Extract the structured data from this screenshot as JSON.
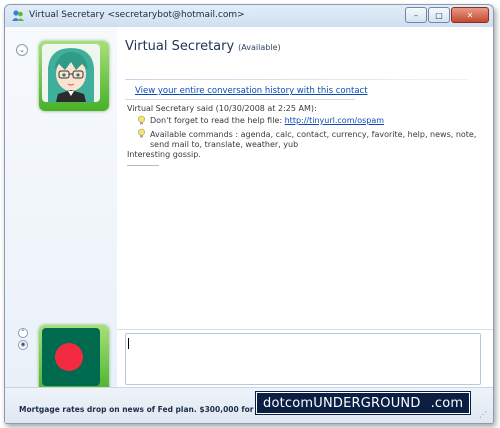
{
  "window": {
    "title": "Virtual Secretary <secretarybot@hotmail.com>",
    "minimize_label": "–",
    "maximize_label": "□",
    "close_label": "✕"
  },
  "contact": {
    "name": "Virtual Secretary",
    "status": "(Available)",
    "avatar_icon": "anime-girl-avatar",
    "own_avatar_icon": "bangladesh-flag"
  },
  "conversation": {
    "history_link": "View your entire conversation history with this contact",
    "said_line": "Virtual Secretary said (10/30/2008 at 2:25 AM):",
    "message1_prefix": "Don't forget to read the help file: ",
    "message1_link": "http://tinyurl.com/ospam",
    "message2": "Available commands : agenda, calc, contact, currency, favorite, help, news, note, send mail to, translate, weather, yub",
    "message3": "Interesting gossip."
  },
  "input": {
    "value": ""
  },
  "ticker": {
    "text": "Mortgage rates drop on news of Fed plan. $300,000 for $1,657/mo."
  },
  "watermark": {
    "text": "dotcomUNDERGROUND",
    "suffix": ".com"
  },
  "colors": {
    "link": "#0b4cb3",
    "frame_green": "#48b02a",
    "flag_green": "#006a4e",
    "flag_red": "#f42a41"
  }
}
